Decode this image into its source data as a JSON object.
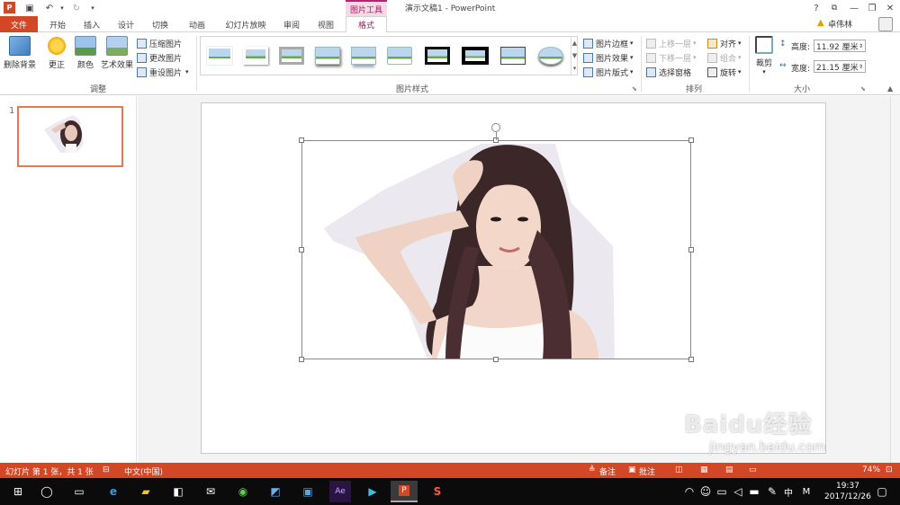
{
  "window": {
    "title": "演示文稿1 - PowerPoint",
    "context_tab": "图片工具",
    "help": "?",
    "minimize": "—",
    "restore": "❐",
    "close": "✕"
  },
  "tabs": [
    "文件",
    "开始",
    "插入",
    "设计",
    "切换",
    "动画",
    "幻灯片放映",
    "审阅",
    "视图",
    "格式"
  ],
  "user": "卓伟林",
  "ribbon": {
    "adjust": {
      "remove_bg": "删除背景",
      "corrections": "更正",
      "color": "颜色",
      "artistic": "艺术效果",
      "compress": "压缩图片",
      "change": "更改图片",
      "reset": "重设图片",
      "group_label": "调整"
    },
    "styles": {
      "border": "图片边框",
      "effects": "图片效果",
      "layout": "图片版式",
      "group_label": "图片样式"
    },
    "arrange": {
      "bring_forward": "上移一层",
      "send_backward": "下移一层",
      "selection_pane": "选择窗格",
      "align": "对齐",
      "group": "组合",
      "rotate": "旋转",
      "group_label": "排列"
    },
    "size": {
      "crop": "裁剪",
      "height_label": "高度:",
      "height_value": "11.92 厘米",
      "width_label": "宽度:",
      "width_value": "21.15 厘米",
      "group_label": "大小"
    }
  },
  "slides_pane": {
    "number": "1"
  },
  "status": {
    "slide_info": "幻灯片 第 1 张，共 1 张",
    "language": "中文(中国)",
    "notes": "备注",
    "comments": "批注",
    "zoom": "74%"
  },
  "taskbar": {
    "time": "19:37",
    "date": "2017/12/26",
    "ime": "中",
    "ime_mode": "M"
  },
  "watermark": {
    "brand": "Baidu经验",
    "url": "jingyan.baidu.com"
  }
}
